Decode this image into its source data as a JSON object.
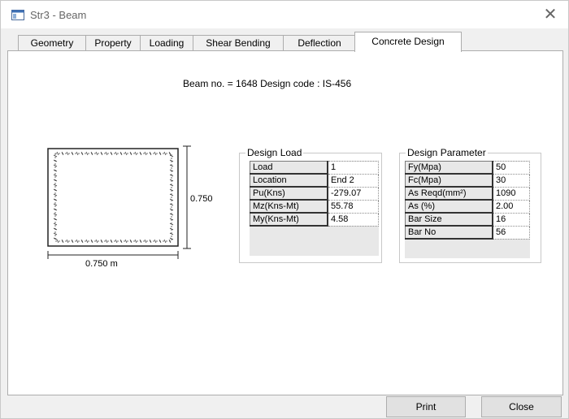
{
  "window": {
    "title": "Str3 - Beam",
    "close_symbol": "✕"
  },
  "tabs": [
    {
      "label": "Geometry"
    },
    {
      "label": "Property"
    },
    {
      "label": "Loading"
    },
    {
      "label": "Shear Bending"
    },
    {
      "label": "Deflection"
    },
    {
      "label": "Concrete Design",
      "active": true
    }
  ],
  "header": {
    "text": "Beam no. = 1648  Design code :  IS-456"
  },
  "section": {
    "height_label": "0.750",
    "width_label": "0.750 m"
  },
  "design_load": {
    "title": "Design Load",
    "rows": [
      {
        "key": "Load",
        "value": "1"
      },
      {
        "key": "Location",
        "value": "End 2"
      },
      {
        "key": "Pu(Kns)",
        "value": "-279.07"
      },
      {
        "key": "Mz(Kns-Mt)",
        "value": "55.78"
      },
      {
        "key": "My(Kns-Mt)",
        "value": "4.58"
      }
    ]
  },
  "design_parameter": {
    "title": "Design Parameter",
    "rows": [
      {
        "key": "Fy(Mpa)",
        "value": "50"
      },
      {
        "key": "Fc(Mpa)",
        "value": "30"
      },
      {
        "key": "As Reqd(mm²)",
        "value": "1090"
      },
      {
        "key": "As (%)",
        "value": "2.00"
      },
      {
        "key": "Bar Size",
        "value": "16"
      },
      {
        "key": "Bar No",
        "value": "56"
      }
    ]
  },
  "buttons": {
    "print": "Print",
    "close": "Close"
  }
}
